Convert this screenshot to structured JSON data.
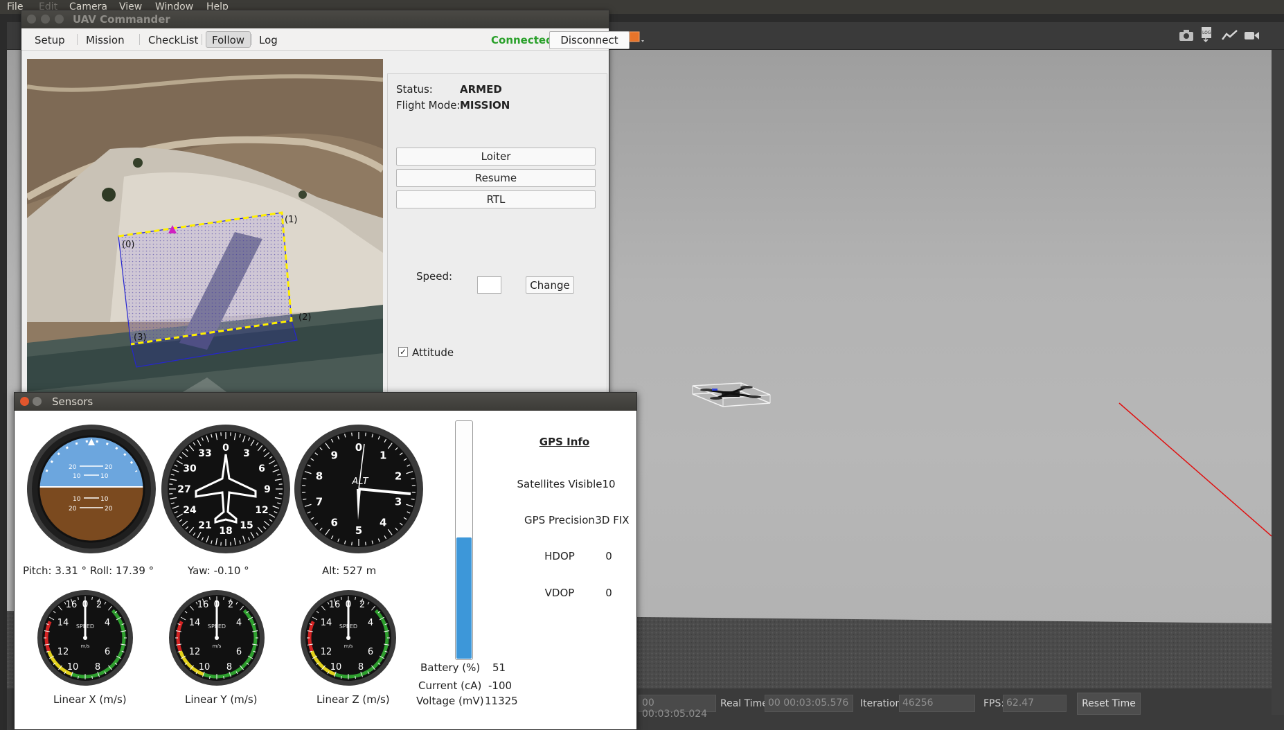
{
  "menubar": {
    "items": [
      "File",
      "Edit",
      "Camera",
      "View",
      "Window",
      "Help"
    ]
  },
  "gazebo": {
    "status": {
      "sim_time": "00 00:03:05.024",
      "real_time_label": "Real Time:",
      "real_time": "00 00:03:05.576",
      "iterations_label": "Iterations:",
      "iterations": "46256",
      "fps_label": "FPS:",
      "fps": "62.47",
      "reset_label": "Reset Time"
    }
  },
  "uav": {
    "title": "UAV Commander",
    "tabs": [
      "Setup",
      "Mission",
      "CheckList",
      "Follow",
      "Log"
    ],
    "active_tab": "Follow",
    "connection": "Connected",
    "disconnect_label": "Disconnect",
    "map": {
      "waypoints": [
        "(0)",
        "(1)",
        "(2)",
        "(3)"
      ]
    },
    "status_label": "Status:",
    "status_value": "ARMED",
    "flight_mode_label": "Flight Mode:",
    "flight_mode_value": "MISSION",
    "buttons": [
      "Loiter",
      "Resume",
      "RTL"
    ],
    "speed_label": "Speed:",
    "speed_value": "",
    "change_label": "Change",
    "attitude_label": "Attitude",
    "attitude_checked": true
  },
  "sensors": {
    "title": "Sensors",
    "pitch_label": "Pitch:",
    "pitch_value": "3.31",
    "roll_label": "Roll:",
    "roll_value": "17.39",
    "deg": "°",
    "yaw_label": "Yaw:",
    "yaw_value": "-0.10",
    "alt_label": "Alt:",
    "alt_value": "527",
    "alt_unit": "m",
    "linear_x_label": "Linear X (m/s)",
    "linear_y_label": "Linear Y (m/s)",
    "linear_z_label": "Linear Z (m/s)",
    "battery_label": "Battery (%)",
    "battery_value": "51",
    "battery_level": 0.51,
    "current_label": "Current (cA)",
    "current_value": "-100",
    "voltage_label": "Voltage (mV)",
    "voltage_value": "11325",
    "gps": {
      "title": "GPS Info",
      "satellites_label": "Satellites Visible",
      "satellites_value": "10",
      "precision_label": "GPS Precision",
      "precision_value": "3D FIX",
      "hdop_label": "HDOP",
      "hdop_value": "0",
      "vdop_label": "VDOP",
      "vdop_value": "0"
    },
    "speed_gauge_text": {
      "top": "0",
      "unit": "m/s",
      "name": "SPEED",
      "ticks": [
        "16",
        "2",
        "14",
        "4",
        "12",
        "6",
        "10",
        "8"
      ]
    },
    "compass_ticks": [
      "0",
      "3",
      "6",
      "9",
      "12",
      "15",
      "18",
      "21",
      "24",
      "27",
      "30",
      "33"
    ],
    "alt_ticks": [
      "0",
      "1",
      "2",
      "3",
      "4",
      "5",
      "6",
      "7",
      "8",
      "9"
    ],
    "horizon_ticks": [
      "20",
      "10",
      "10",
      "20"
    ],
    "colors": {
      "connected": "#2aa02a",
      "battery": "#3d97d9",
      "sky": "#6ca6de",
      "ground": "#7b4a1f"
    }
  }
}
